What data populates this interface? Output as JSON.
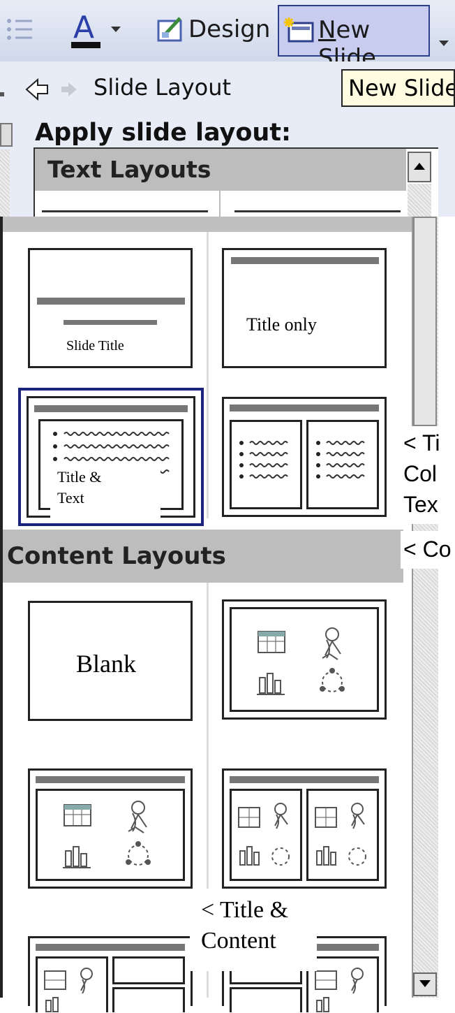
{
  "toolbar": {
    "design_label": "Design",
    "new_slide_label": "New Slide",
    "new_slide_mnemonic": "N",
    "new_slide_rest": "ew Slide"
  },
  "tooltip": {
    "text": "New Slide"
  },
  "task_pane": {
    "title": "Slide Layout",
    "apply_label": "Apply slide layout:"
  },
  "gallery": {
    "sections": [
      {
        "label": "Text Layouts"
      },
      {
        "label": "Content Layouts"
      }
    ],
    "captions": {
      "slide_title": "Slide Title",
      "title_only": "Title only",
      "title_text_1": "Title &",
      "title_text_2": "Text",
      "blank": "Blank"
    }
  },
  "annotations": {
    "two_col_1": "< Ti",
    "two_col_2": "Col",
    "two_col_3": "Tex",
    "content": "< Co",
    "title_content_1": "< Title &",
    "title_content_2": "Content"
  },
  "colors": {
    "toolbar": "#dfe5f2",
    "selected_border": "#1a237e",
    "section_header": "#bdbdbd",
    "tooltip_bg": "#fffde1"
  }
}
